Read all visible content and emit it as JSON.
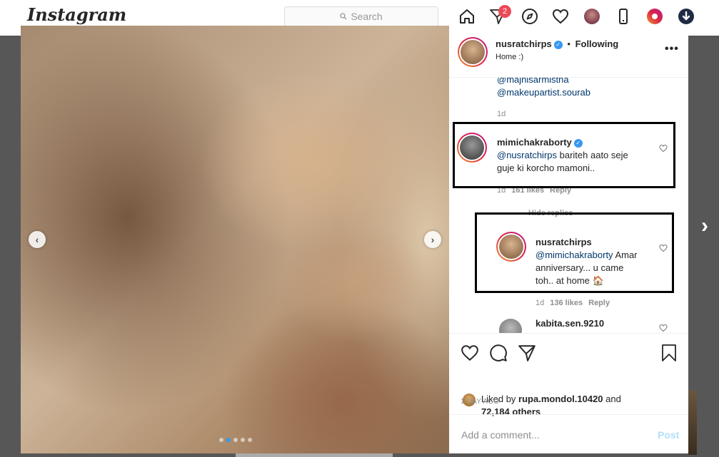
{
  "topbar": {
    "logo": "Instagram",
    "search_placeholder": "Search",
    "notification_count": "2"
  },
  "post": {
    "header": {
      "username": "nusratchirps",
      "separator": "•",
      "follow_status": "Following",
      "location": "Home :)"
    },
    "caption_tail": {
      "mention1": "@majhisarmistha",
      "mention2": "@makeupartist.sourab",
      "time": "1d"
    },
    "comments": [
      {
        "username": "mimichakraborty",
        "mention": "@nusratchirps",
        "text_line1": " bariteh aato seje",
        "text_line2": "guje ki korcho mamoni..",
        "time": "1d",
        "likes": "161 likes",
        "reply": "Reply",
        "hide_replies": "Hide replies"
      },
      {
        "username": "nusratchirps",
        "mention": "@mimichakraborty",
        "text_line1": " Amar",
        "text_line2": "anniversary... u came",
        "text_line3": "toh.. at home 🏠",
        "time": "1d",
        "likes": "136 likes",
        "reply": "Reply"
      },
      {
        "username": "kabita.sen.9210"
      }
    ],
    "liked_by_prefix": "Liked by ",
    "liked_by_user": "rupa.mondol.10420",
    "liked_by_and": " and",
    "liked_by_others": "72,184 others",
    "date": "1 DAY AGO",
    "add_comment_placeholder": "Add a comment...",
    "post_button": "Post",
    "carousel": {
      "slide_count": 5,
      "active_slide": 2
    }
  },
  "colors": {
    "accent": "#3897f0",
    "badge": "#ed4956",
    "mention": "#00376b",
    "highlight_box": "#000000"
  },
  "icons": [
    "home-icon",
    "direct-icon",
    "explore-icon",
    "activity-icon",
    "profile-icon",
    "phone-icon",
    "extension-icon",
    "download-icon",
    "heart-icon",
    "comment-icon",
    "share-icon",
    "save-icon",
    "verified-icon",
    "chevron-left-icon",
    "chevron-right-icon"
  ]
}
